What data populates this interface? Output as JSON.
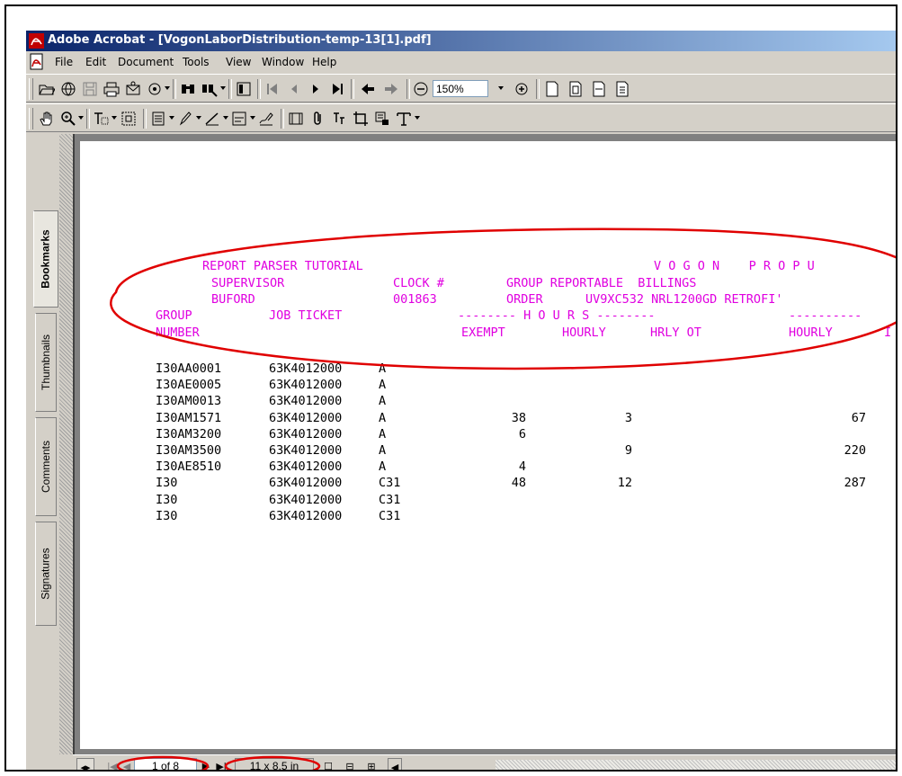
{
  "window": {
    "title": "Adobe Acrobat - [VogonLaborDistribution-temp-13[1].pdf]",
    "title_bar_color": "#0a246a"
  },
  "menu": [
    "File",
    "Edit",
    "Document",
    "Tools",
    "View",
    "Window",
    "Help"
  ],
  "toolbar": {
    "zoom_value": "150%"
  },
  "nav_tabs": [
    "Bookmarks",
    "Thumbnails",
    "Comments",
    "Signatures"
  ],
  "report": {
    "text_color": "#e000e0",
    "header_lines": [
      "REPORT PARSER TUTORIAL",
      "V O G O N    P R O P U",
      "SUPERVISOR",
      "CLOCK #",
      "GROUP REPORTABLE  BILLINGS",
      "BUFORD",
      "001863",
      "ORDER",
      "UV9XC532 NRL1200GD RETROFI'",
      "GROUP",
      "JOB TICKET",
      "-------- H O U R S --------",
      "----------",
      "NUMBER",
      "EXEMPT",
      "HOURLY",
      "HRLY OT",
      "HOURLY",
      "I"
    ],
    "rows": [
      {
        "group": "I30AA0001",
        "ticket": "63K4012000",
        "code": "A",
        "exempt": "",
        "hourly": "",
        "hrly_ot": "",
        "hourly2": ""
      },
      {
        "group": "I30AE0005",
        "ticket": "63K4012000",
        "code": "A",
        "exempt": "",
        "hourly": "",
        "hrly_ot": "",
        "hourly2": ""
      },
      {
        "group": "I30AM0013",
        "ticket": "63K4012000",
        "code": "A",
        "exempt": "",
        "hourly": "",
        "hrly_ot": "",
        "hourly2": ""
      },
      {
        "group": "I30AM1571",
        "ticket": "63K4012000",
        "code": "A",
        "exempt": "38",
        "hourly": "3",
        "hrly_ot": "",
        "hourly2": "67"
      },
      {
        "group": "I30AM3200",
        "ticket": "63K4012000",
        "code": "A",
        "exempt": "6",
        "hourly": "",
        "hrly_ot": "",
        "hourly2": ""
      },
      {
        "group": "I30AM3500",
        "ticket": "63K4012000",
        "code": "A",
        "exempt": "",
        "hourly": "9",
        "hrly_ot": "",
        "hourly2": "220"
      },
      {
        "group": "I30AE8510",
        "ticket": "63K4012000",
        "code": "A",
        "exempt": "4",
        "hourly": "",
        "hrly_ot": "",
        "hourly2": ""
      },
      {
        "group": "I30",
        "ticket": "63K4012000",
        "code": "C31",
        "exempt": "48",
        "hourly": "12",
        "hrly_ot": "",
        "hourly2": "287"
      },
      {
        "group": "I30",
        "ticket": "63K4012000",
        "code": "C31",
        "exempt": "",
        "hourly": "",
        "hrly_ot": "",
        "hourly2": ""
      },
      {
        "group": "I30",
        "ticket": "63K4012000",
        "code": "C31",
        "exempt": "",
        "hourly": "",
        "hrly_ot": "",
        "hourly2": ""
      }
    ]
  },
  "status": {
    "page_of": "1 of 8",
    "page_size": "11 x 8.5 in"
  },
  "annotation_color": "#e00000"
}
